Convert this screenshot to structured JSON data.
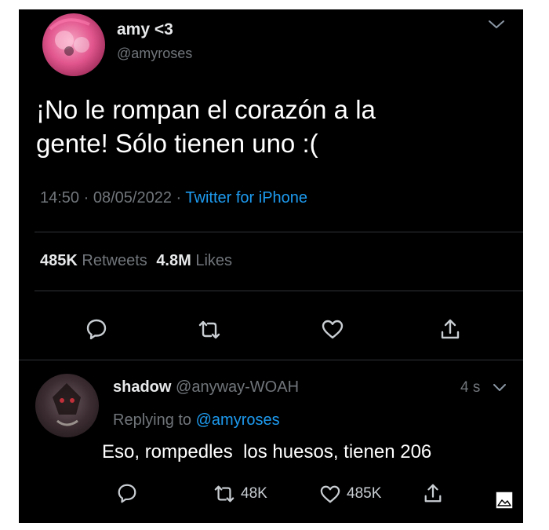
{
  "tweet": {
    "display_name": "amy <3",
    "handle": "@amyroses",
    "text_line1": "¡No le rompan el corazón a la",
    "text_line2": "gente! Sólo tienen uno :(",
    "time": "14:50",
    "dot": "·",
    "date": "08/05/2022",
    "source": "Twitter for iPhone",
    "retweets_count": "485K",
    "retweets_label": "Retweets",
    "likes_count": "4.8M",
    "likes_label": "Likes"
  },
  "reply": {
    "display_name": "shadow",
    "handle": "@anyway-WOAH",
    "time": "4 s",
    "replying_label": "Replying to",
    "replying_handle": "@amyroses",
    "text": "Eso, rompedles  los huesos, tienen 206",
    "retweets": "48K",
    "likes": "485K"
  },
  "icons": {
    "menu": "chevron-down-icon",
    "reply": "comment-icon",
    "retweet": "retweet-icon",
    "like": "heart-icon",
    "share": "share-icon",
    "media": "image-icon"
  },
  "colors": {
    "background": "#000000",
    "link": "#1d9bf0",
    "muted": "#71767b"
  }
}
